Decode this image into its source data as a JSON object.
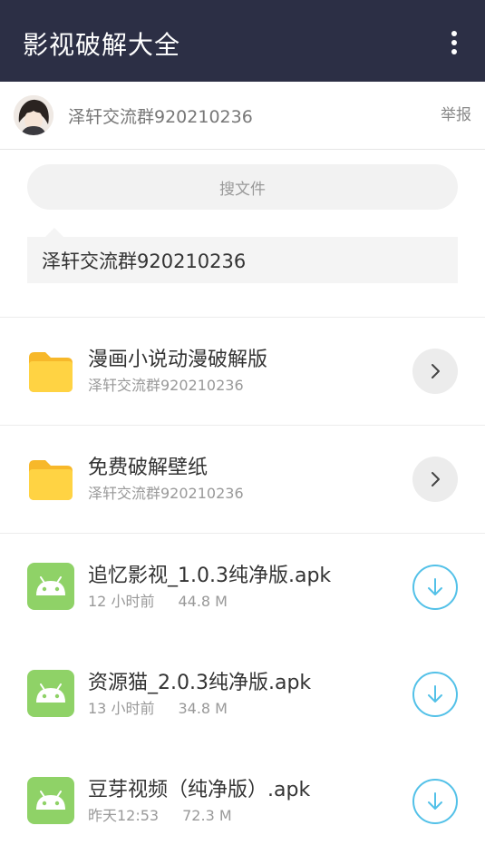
{
  "app_bar": {
    "title": "影视破解大全",
    "more_icon": "more-vert-icon"
  },
  "owner": {
    "name": "泽轩交流群920210236",
    "report_label": "举报"
  },
  "search": {
    "label": "搜文件"
  },
  "tip": {
    "text": "泽轩交流群920210236"
  },
  "folders": [
    {
      "name": "漫画小说动漫破解版",
      "subtitle": "泽轩交流群920210236"
    },
    {
      "name": "免费破解壁纸",
      "subtitle": "泽轩交流群920210236"
    }
  ],
  "files": [
    {
      "name": "追忆影视_1.0.3纯净版.apk",
      "time": "12 小时前",
      "size": "44.8 M"
    },
    {
      "name": "资源猫_2.0.3纯净版.apk",
      "time": "13 小时前",
      "size": "34.8 M"
    },
    {
      "name": "豆芽视频（纯净版）.apk",
      "time": "昨天12:53",
      "size": "72.3 M"
    }
  ],
  "colors": {
    "app_bar": "#2c2f45",
    "folder": "#ffd343",
    "apk": "#8fd267",
    "download": "#53c1e8"
  }
}
